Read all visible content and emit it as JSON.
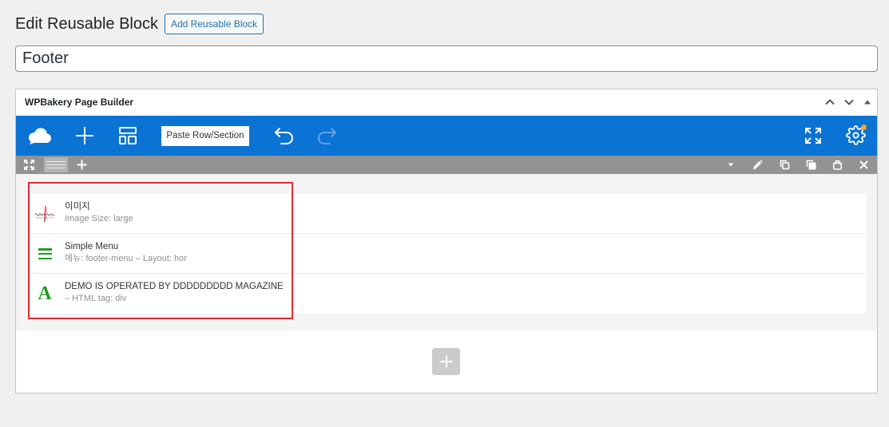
{
  "header": {
    "title": "Edit Reusable Block",
    "add_button_label": "Add Reusable Block"
  },
  "title_field": {
    "value": "Footer"
  },
  "builder": {
    "title": "WPBakery Page Builder",
    "box_controls": [
      "chevron-up-icon",
      "chevron-down-icon",
      "triangle-up-icon"
    ],
    "navbar": {
      "logo_icon": "cloud-icon",
      "left_icons": [
        "plus-icon",
        "layout-icon"
      ],
      "paste_label": "Paste Row/Section",
      "history_icons": [
        "undo-icon",
        "redo-icon"
      ],
      "redo_disabled": true,
      "right_icons": [
        "fullscreen-icon",
        "gear-icon"
      ],
      "settings_notification": true
    },
    "row_controls": {
      "left": [
        "expand-icon",
        "drag-handle-icon",
        "plus-icon"
      ],
      "right": [
        "caret-down-icon",
        "pencil-icon",
        "copy-icon",
        "clone-icon",
        "bag-icon",
        "close-icon"
      ]
    },
    "elements": [
      {
        "icon": "image-thumbnail",
        "title": "이미지",
        "meta": "Image Size: large"
      },
      {
        "icon": "menu-icon",
        "title": "Simple Menu",
        "meta": "메뉴: footer-menu – Layout: hor"
      },
      {
        "icon": "text-icon",
        "icon_glyph": "A",
        "title": "DEMO IS OPERATED BY DDDDDDDDD MAGAZINE",
        "meta": "– HTML tag: div"
      }
    ],
    "add_element_icon": "plus-icon"
  },
  "colors": {
    "navbar_blue": "#0a73d3",
    "row_controls_gray": "#939393",
    "element_icon_green": "#1f9d1f",
    "primary_link": "#2271b1",
    "notification_dot": "#f5a623",
    "highlight_red": "#e02b35"
  }
}
